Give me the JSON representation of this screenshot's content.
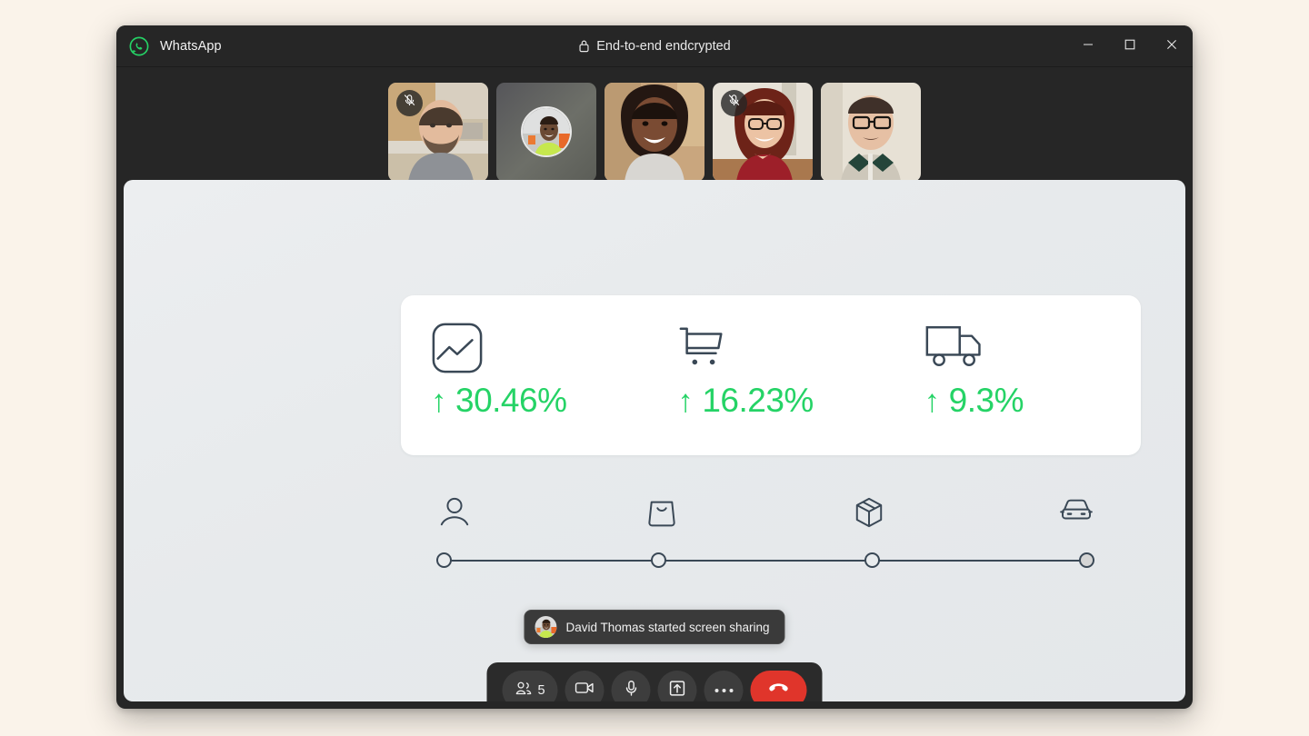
{
  "window": {
    "app_name": "WhatsApp",
    "encryption_label": "End-to-end endcrypted",
    "logo_icon": "whatsapp-logo-icon",
    "lock_icon": "lock-icon",
    "controls": {
      "minimize": "minimize-icon",
      "maximize": "maximize-icon",
      "close": "close-icon"
    },
    "accent_green": "#25d366",
    "end_call_red": "#e0352b",
    "titlebar_bg": "#262626",
    "page_bg": "#faf3ea"
  },
  "participants": [
    {
      "id": 1,
      "muted": true,
      "camera_on": true,
      "mute_icon": "mic-off-icon"
    },
    {
      "id": 2,
      "muted": false,
      "camera_on": false,
      "mute_icon": ""
    },
    {
      "id": 3,
      "muted": false,
      "camera_on": true,
      "mute_icon": ""
    },
    {
      "id": 4,
      "muted": true,
      "camera_on": true,
      "mute_icon": "mic-off-icon"
    },
    {
      "id": 5,
      "muted": false,
      "camera_on": true,
      "mute_icon": ""
    }
  ],
  "shared_screen": {
    "stats": [
      {
        "icon": "chart-image-icon",
        "arrow": "↑",
        "value": "30.46%"
      },
      {
        "icon": "shopping-cart-icon",
        "arrow": "↑",
        "value": "16.23%"
      },
      {
        "icon": "delivery-truck-icon",
        "arrow": "↑",
        "value": "9.3%"
      }
    ],
    "stat_color": "#25d366",
    "icon_color": "#3a4856",
    "timeline": {
      "steps": [
        {
          "icon": "person-icon",
          "state": "open"
        },
        {
          "icon": "shopping-bag-icon",
          "state": "open"
        },
        {
          "icon": "package-box-icon",
          "state": "open"
        },
        {
          "icon": "car-front-icon",
          "state": "filled"
        }
      ]
    }
  },
  "toast": {
    "avatar_icon": "participant-avatar",
    "message": "David Thomas started screen sharing"
  },
  "controls": {
    "participants": {
      "icon": "people-icon",
      "count": "5"
    },
    "camera": {
      "icon": "video-camera-icon"
    },
    "microphone": {
      "icon": "microphone-icon"
    },
    "share_screen": {
      "icon": "share-screen-icon"
    },
    "more": {
      "icon": "more-dots-icon"
    },
    "end_call": {
      "icon": "end-call-icon"
    }
  }
}
